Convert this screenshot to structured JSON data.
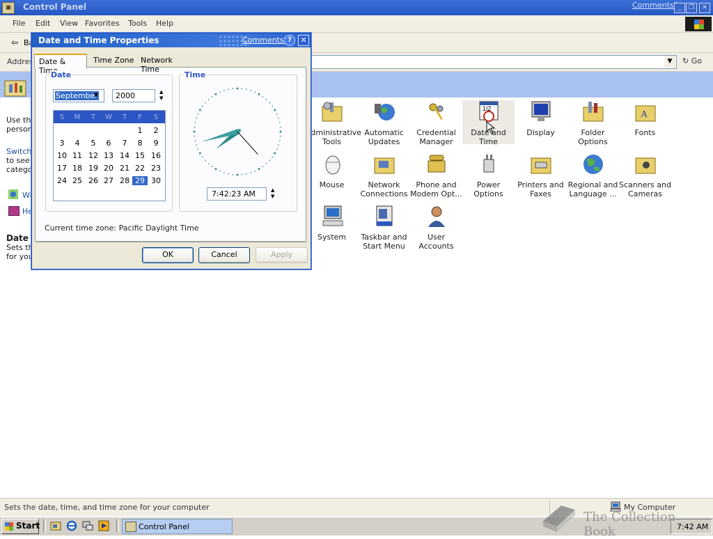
{
  "window": {
    "title": "Control Panel",
    "comments_link": "Comments?",
    "menu": [
      "File",
      "Edit",
      "View",
      "Favorites",
      "Tools",
      "Help"
    ],
    "toolbar_back": "Ba",
    "address_label": "Addres",
    "go_label": "Go"
  },
  "left_pane": {
    "line1": "Use the",
    "line2": "person.",
    "switch_link": "Switch",
    "switch_l2": "to see i",
    "switch_l3": "catego",
    "link_windows": "Wi",
    "link_help": "He",
    "details_title": "Date a",
    "details_l1": "Sets th",
    "details_l2": "for you"
  },
  "icons": [
    {
      "id": "admin",
      "label": "Administrative Tools",
      "icon": "admin-tools-icon"
    },
    {
      "id": "updates",
      "label": "Automatic Updates",
      "icon": "globe-update-icon"
    },
    {
      "id": "cred",
      "label": "Credential Manager",
      "icon": "keys-icon"
    },
    {
      "id": "datetime",
      "label": "Date and Time",
      "icon": "calendar-clock-icon"
    },
    {
      "id": "display",
      "label": "Display",
      "icon": "monitor-icon"
    },
    {
      "id": "folder",
      "label": "Folder Options",
      "icon": "folder-options-icon"
    },
    {
      "id": "fonts",
      "label": "Fonts",
      "icon": "fonts-folder-icon"
    },
    {
      "id": "mouse",
      "label": "Mouse",
      "icon": "mouse-icon"
    },
    {
      "id": "network",
      "label": "Network Connections",
      "icon": "network-icon"
    },
    {
      "id": "phone",
      "label": "Phone and Modem Opt...",
      "icon": "phone-icon"
    },
    {
      "id": "power",
      "label": "Power Options",
      "icon": "power-plug-icon"
    },
    {
      "id": "printers",
      "label": "Printers and Faxes",
      "icon": "printer-icon"
    },
    {
      "id": "regional",
      "label": "Regional and Language ...",
      "icon": "globe-icon"
    },
    {
      "id": "scanners",
      "label": "Scanners and Cameras",
      "icon": "scanner-icon"
    },
    {
      "id": "system",
      "label": "System",
      "icon": "computer-icon"
    },
    {
      "id": "taskbar",
      "label": "Taskbar and Start Menu",
      "icon": "taskbar-icon"
    },
    {
      "id": "users",
      "label": "User Accounts",
      "icon": "users-icon"
    }
  ],
  "dialog": {
    "title": "Date and Time Properties",
    "comments_link": "Comments?",
    "help": "?",
    "tabs": [
      "Date & Time",
      "Time Zone",
      "Network Time"
    ],
    "date_group": "Date",
    "time_group": "Time",
    "month": "September",
    "year": "2000",
    "weekdays": [
      "S",
      "M",
      "T",
      "W",
      "T",
      "F",
      "S"
    ],
    "days": [
      [
        "",
        "",
        "",
        "",
        "",
        "1",
        "2"
      ],
      [
        "3",
        "4",
        "5",
        "6",
        "7",
        "8",
        "9"
      ],
      [
        "10",
        "11",
        "12",
        "13",
        "14",
        "15",
        "16"
      ],
      [
        "17",
        "18",
        "19",
        "20",
        "21",
        "22",
        "23"
      ],
      [
        "24",
        "25",
        "26",
        "27",
        "28",
        "29",
        "30"
      ]
    ],
    "selected_day": "29",
    "time_value": "7:42:23 AM",
    "clock": {
      "hour": 7,
      "minute": 42,
      "second": 23
    },
    "timezone_label": "Current time zone:  Pacific Daylight Time",
    "ok": "OK",
    "cancel": "Cancel",
    "apply": "Apply"
  },
  "status": {
    "text": "Sets the date, time, and time zone for your computer",
    "zone": "My Computer"
  },
  "taskbar": {
    "start": "Start",
    "task": "Control Panel",
    "clock": "7:42 AM"
  },
  "watermark": "The Collection Book",
  "colors": {
    "titlebar": "#2658c4",
    "banner": "#a9c1ee",
    "calendar_header": "#2d56c5",
    "clock_hand": "#2b8a8a"
  }
}
